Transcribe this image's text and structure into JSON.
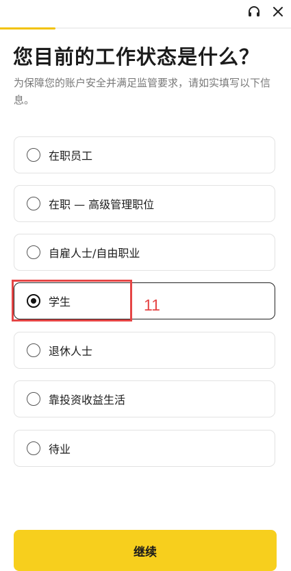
{
  "header": {
    "support_icon": "headset-icon",
    "close_icon": "close-icon",
    "progress": 0.19
  },
  "title": "您目前的工作状态是什么？",
  "subtitle": "为保障您的账户安全并满足监管要求，请如实填写以下信息。",
  "options": [
    {
      "label": "在职员工",
      "selected": false
    },
    {
      "label": "在职 — 高级管理职位",
      "selected": false
    },
    {
      "label": "自雇人士/自由职业",
      "selected": false
    },
    {
      "label": "学生",
      "selected": true
    },
    {
      "label": "退休人士",
      "selected": false
    },
    {
      "label": "靠投资收益生活",
      "selected": false
    },
    {
      "label": "待业",
      "selected": false
    }
  ],
  "annotation": {
    "number": "11",
    "color": "#e54545"
  },
  "continue_label": "继续",
  "colors": {
    "accent": "#f7cf1d",
    "progress": "#f2c200"
  }
}
